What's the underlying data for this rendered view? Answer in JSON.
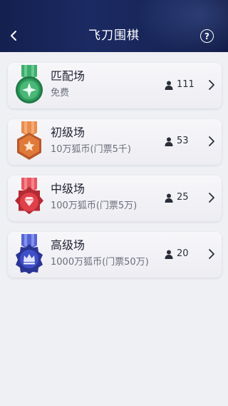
{
  "header": {
    "title": "飞刀围棋",
    "back_icon": "chevron-left-icon",
    "help_icon": "question-circle-icon",
    "help_glyph": "?"
  },
  "rooms": [
    {
      "name": "匹配场",
      "fee": "免费",
      "players": "111",
      "color": "#2f9a5c",
      "ribbon": "#3cae6d",
      "emblem": "star-sparkle"
    },
    {
      "name": "初级场",
      "fee": "10万狐币(门票5千)",
      "players": "53",
      "color": "#e07a3a",
      "ribbon": "#ea8c4c",
      "emblem": "star"
    },
    {
      "name": "中级场",
      "fee": "100万狐币(门票5万)",
      "players": "25",
      "color": "#e0404a",
      "ribbon": "#ea5560",
      "emblem": "diamond"
    },
    {
      "name": "高级场",
      "fee": "1000万狐币(门票50万)",
      "players": "20",
      "color": "#3f4fc8",
      "ribbon": "#5565d8",
      "emblem": "crown"
    }
  ]
}
